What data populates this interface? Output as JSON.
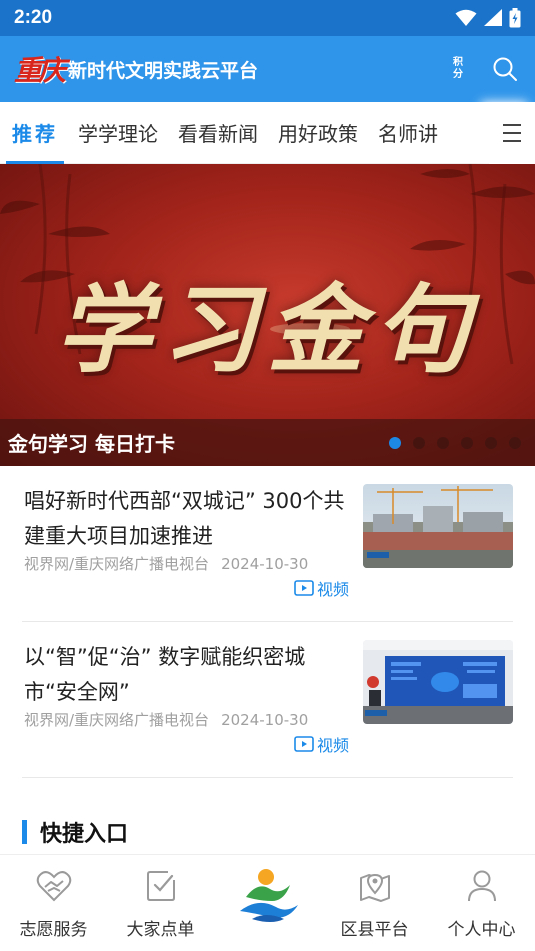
{
  "status_bar": {
    "time": "2:20"
  },
  "header": {
    "logo_mark": "重庆",
    "app_title": "新时代文明实践云平台",
    "points_label": "积分"
  },
  "tabs": [
    {
      "label": "推荐",
      "active": true
    },
    {
      "label": "学学理论",
      "active": false
    },
    {
      "label": "看看新闻",
      "active": false
    },
    {
      "label": "用好政策",
      "active": false
    },
    {
      "label": "名师讲",
      "active": false
    }
  ],
  "banner": {
    "title": "学习金句",
    "caption": "金句学习 每日打卡",
    "dot_count": 6,
    "active_dot": 0
  },
  "news": [
    {
      "title": "唱好新时代西部“双城记” 300个共建重大项目加速推进",
      "source": "视界网/重庆网络广播电视台",
      "date": "2024-10-30",
      "tag": "视频"
    },
    {
      "title": "以“智”促“治” 数字赋能织密城市“安全网”",
      "source": "视界网/重庆网络广播电视台",
      "date": "2024-10-30",
      "tag": "视频"
    }
  ],
  "shortcut": {
    "title": "快捷入口"
  },
  "bottom_nav": [
    {
      "label": "志愿服务",
      "icon": "heart-hands-icon"
    },
    {
      "label": "大家点单",
      "icon": "checklist-icon"
    },
    {
      "label": "",
      "icon": "center-logo-icon"
    },
    {
      "label": "区县平台",
      "icon": "map-pin-icon"
    },
    {
      "label": "个人中心",
      "icon": "person-icon"
    }
  ],
  "colors": {
    "status_bar": "#1b74c9",
    "header": "#2f95ea",
    "accent": "#1b8ae8",
    "banner_red": "#a3241b",
    "banner_gold": "#f1dfb0"
  }
}
